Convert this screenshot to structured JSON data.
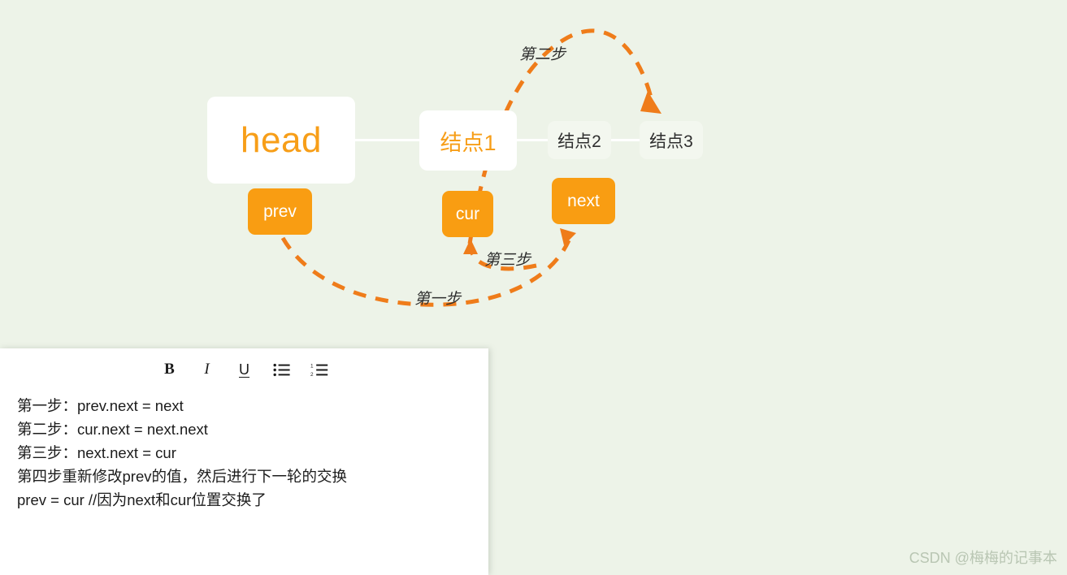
{
  "canvas": {
    "background_color": "#edf3e8",
    "accent_orange": "#f99d12",
    "arrow_orange": "#ef7c1a",
    "node_white": "#ffffff",
    "node_pale": "#f3f7ef"
  },
  "diagram": {
    "nodes": [
      {
        "id": "head",
        "label": "head",
        "style": "white-orange-text"
      },
      {
        "id": "node1",
        "label": "结点1",
        "style": "white-orange-text"
      },
      {
        "id": "node2",
        "label": "结点2",
        "style": "pale-dark-text"
      },
      {
        "id": "node3",
        "label": "结点3",
        "style": "pale-dark-text"
      },
      {
        "id": "prev",
        "label": "prev",
        "style": "orange-white-text"
      },
      {
        "id": "cur",
        "label": "cur",
        "style": "orange-white-text"
      },
      {
        "id": "next",
        "label": "next",
        "style": "orange-white-text"
      }
    ],
    "step_labels": {
      "step1": "第一步",
      "step2": "第二步",
      "step3": "第三步"
    }
  },
  "editor": {
    "toolbar": {
      "bold": "B",
      "italic": "I",
      "underline": "U",
      "bullet_list": "bullet-list-icon",
      "numbered_list": "numbered-list-icon"
    },
    "lines": [
      "第一步：prev.next = next",
      "第二步：cur.next = next.next",
      "第三步：next.next = cur",
      "第四步重新修改prev的值，然后进行下一轮的交换",
      "prev = cur //因为next和cur位置交换了"
    ]
  },
  "watermark": {
    "text": "CSDN @梅梅的记事本"
  }
}
